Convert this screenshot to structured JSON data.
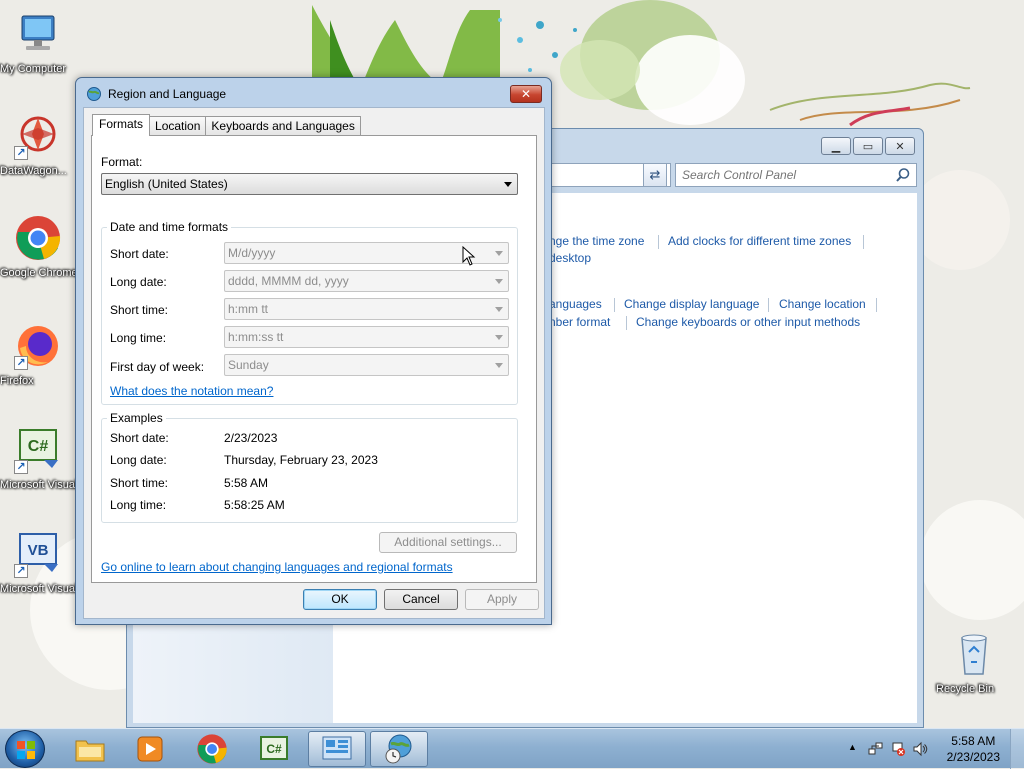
{
  "desktop": {
    "icons": [
      {
        "label": "My Computer"
      },
      {
        "label": "DataWagon..."
      },
      {
        "label": "Google Chrome"
      },
      {
        "label": "Firefox"
      },
      {
        "label": "Microsoft Visual C# ..."
      },
      {
        "label": "Microsoft Visual Basi..."
      },
      {
        "label": "Recycle Bin"
      }
    ]
  },
  "control_panel": {
    "search_placeholder": "Search Control Panel",
    "links": {
      "change_time_zone": "nge the time zone",
      "add_clocks": "Add clocks for different time zones",
      "desktop": "desktop",
      "languages": "anguages",
      "change_display_language": "Change display language",
      "change_location": "Change location",
      "number_format": "nber format",
      "change_keyboards": "Change keyboards or other input methods"
    }
  },
  "dialog": {
    "title": "Region and Language",
    "close_label": "✕",
    "tabs": [
      {
        "label": "Formats"
      },
      {
        "label": "Location"
      },
      {
        "label": "Keyboards and Languages"
      }
    ],
    "format_label": "Format:",
    "format_value": "English (United States)",
    "date_time_group": "Date and time formats",
    "rows": [
      {
        "label": "Short date:",
        "value": "M/d/yyyy"
      },
      {
        "label": "Long date:",
        "value": "dddd, MMMM dd, yyyy"
      },
      {
        "label": "Short time:",
        "value": "h:mm tt"
      },
      {
        "label": "Long time:",
        "value": "h:mm:ss tt"
      },
      {
        "label": "First day of week:",
        "value": "Sunday"
      }
    ],
    "notation_link": "What does the notation mean?",
    "examples_group": "Examples",
    "examples": [
      {
        "label": "Short date:",
        "value": "2/23/2023"
      },
      {
        "label": "Long date:",
        "value": "Thursday, February 23, 2023"
      },
      {
        "label": "Short time:",
        "value": "5:58 AM"
      },
      {
        "label": "Long time:",
        "value": "5:58:25 AM"
      }
    ],
    "additional_settings": "Additional settings...",
    "online_link": "Go online to learn about changing languages and regional formats",
    "ok": "OK",
    "cancel": "Cancel",
    "apply": "Apply"
  },
  "taskbar": {
    "time": "5:58 AM",
    "date": "2/23/2023"
  }
}
